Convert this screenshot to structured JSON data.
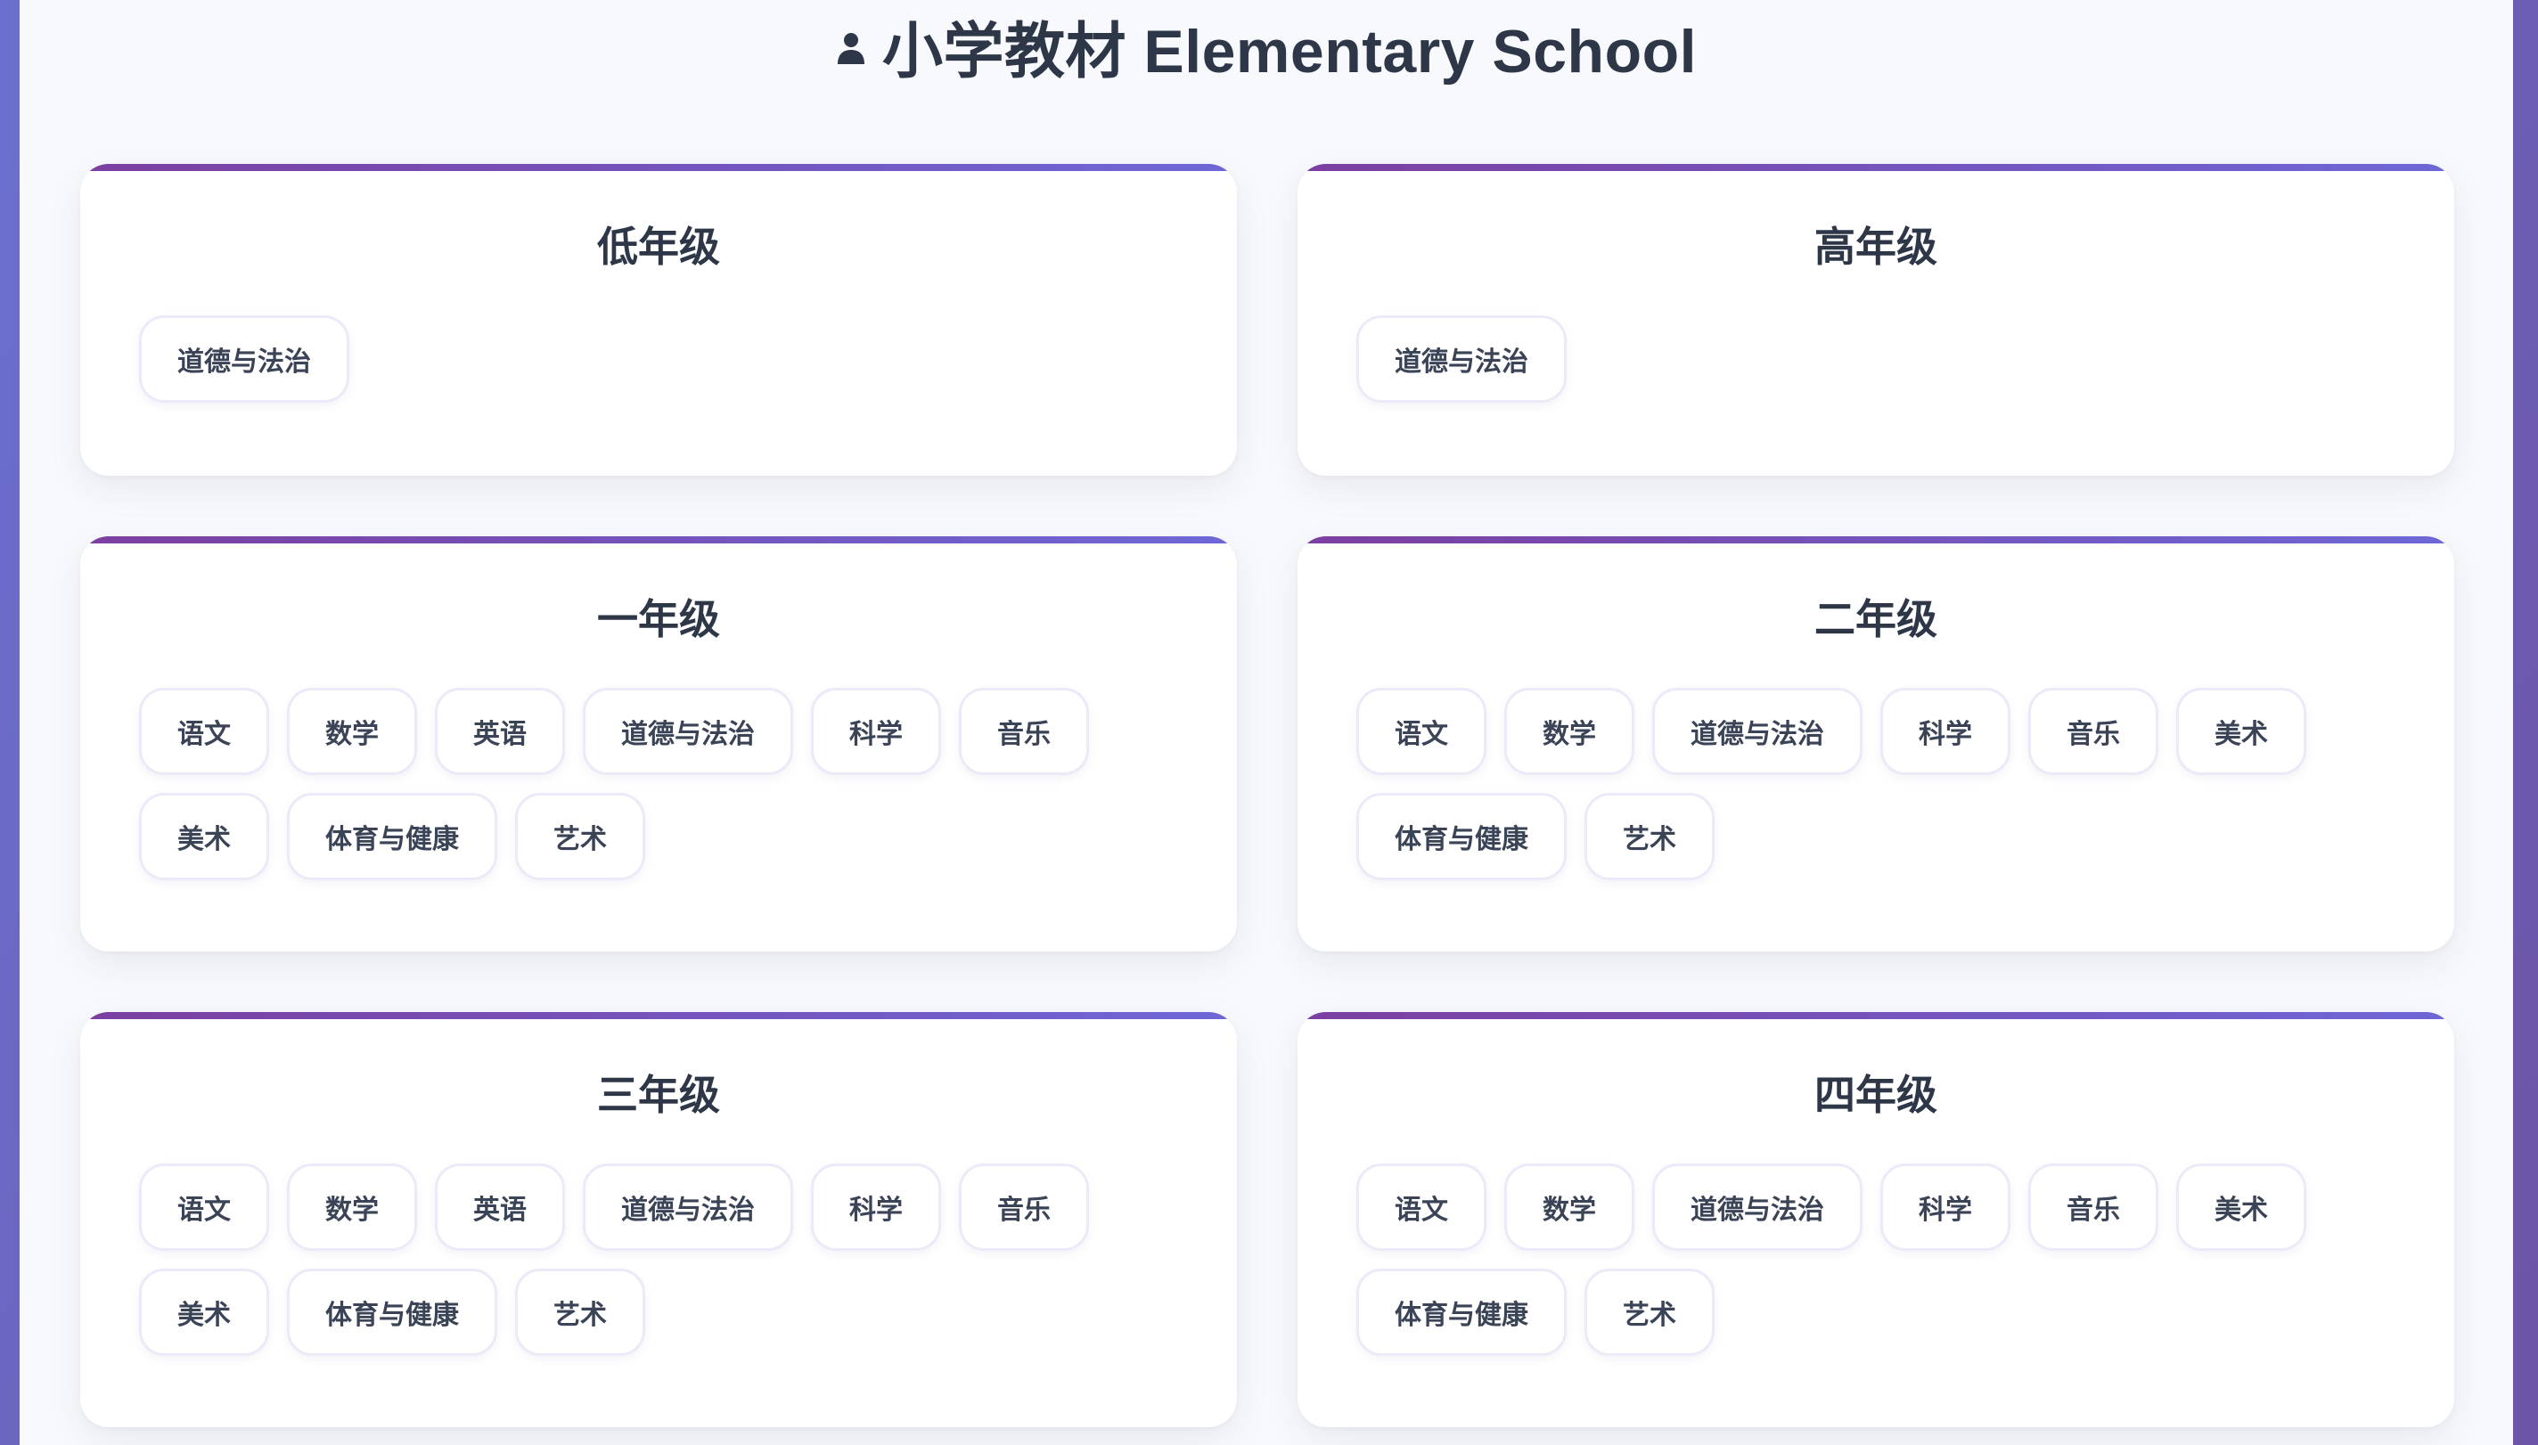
{
  "header": {
    "icon": "user-icon",
    "title": "小学教材 Elementary School"
  },
  "colors": {
    "background_start": "#6b70cf",
    "background_end": "#6c54a6",
    "accent_start": "#7b3fa0",
    "accent_end": "#6e67d6",
    "title_text": "#2d3748"
  },
  "cards": [
    {
      "title": "低年级",
      "subjects": [
        "道德与法治"
      ]
    },
    {
      "title": "高年级",
      "subjects": [
        "道德与法治"
      ]
    },
    {
      "title": "一年级",
      "subjects": [
        "语文",
        "数学",
        "英语",
        "道德与法治",
        "科学",
        "音乐",
        "美术",
        "体育与健康",
        "艺术"
      ]
    },
    {
      "title": "二年级",
      "subjects": [
        "语文",
        "数学",
        "道德与法治",
        "科学",
        "音乐",
        "美术",
        "体育与健康",
        "艺术"
      ]
    },
    {
      "title": "三年级",
      "subjects": [
        "语文",
        "数学",
        "英语",
        "道德与法治",
        "科学",
        "音乐",
        "美术",
        "体育与健康",
        "艺术"
      ]
    },
    {
      "title": "四年级",
      "subjects": [
        "语文",
        "数学",
        "道德与法治",
        "科学",
        "音乐",
        "美术",
        "体育与健康",
        "艺术"
      ]
    }
  ]
}
